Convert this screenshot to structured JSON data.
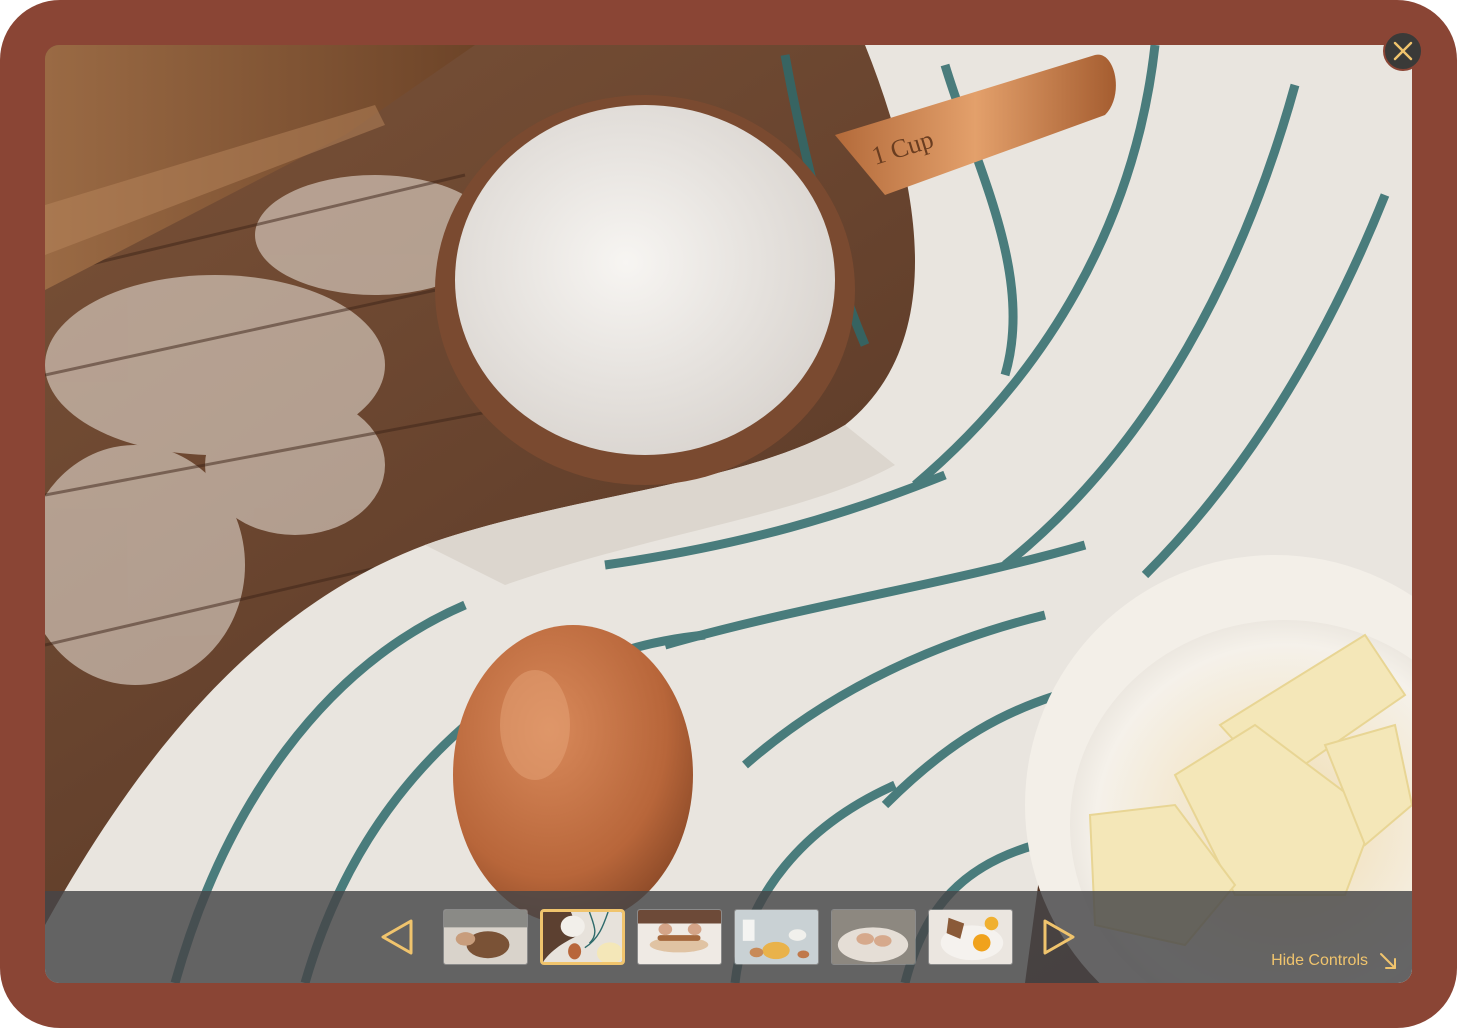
{
  "viewer": {
    "close_icon": "close-icon",
    "prev_icon": "triangle-left-icon",
    "next_icon": "triangle-right-icon",
    "hide_controls_label": "Hide Controls",
    "hide_controls_icon": "arrow-down-right-icon",
    "accent_color": "#f0c46d",
    "frame_color": "#8a4535"
  },
  "main_photo": {
    "cup_engraving": "1 Cup"
  },
  "thumbnails": [
    {
      "id": "thumb-1",
      "active": false
    },
    {
      "id": "thumb-2",
      "active": true
    },
    {
      "id": "thumb-3",
      "active": false
    },
    {
      "id": "thumb-4",
      "active": false
    },
    {
      "id": "thumb-5",
      "active": false
    },
    {
      "id": "thumb-6",
      "active": false
    }
  ]
}
